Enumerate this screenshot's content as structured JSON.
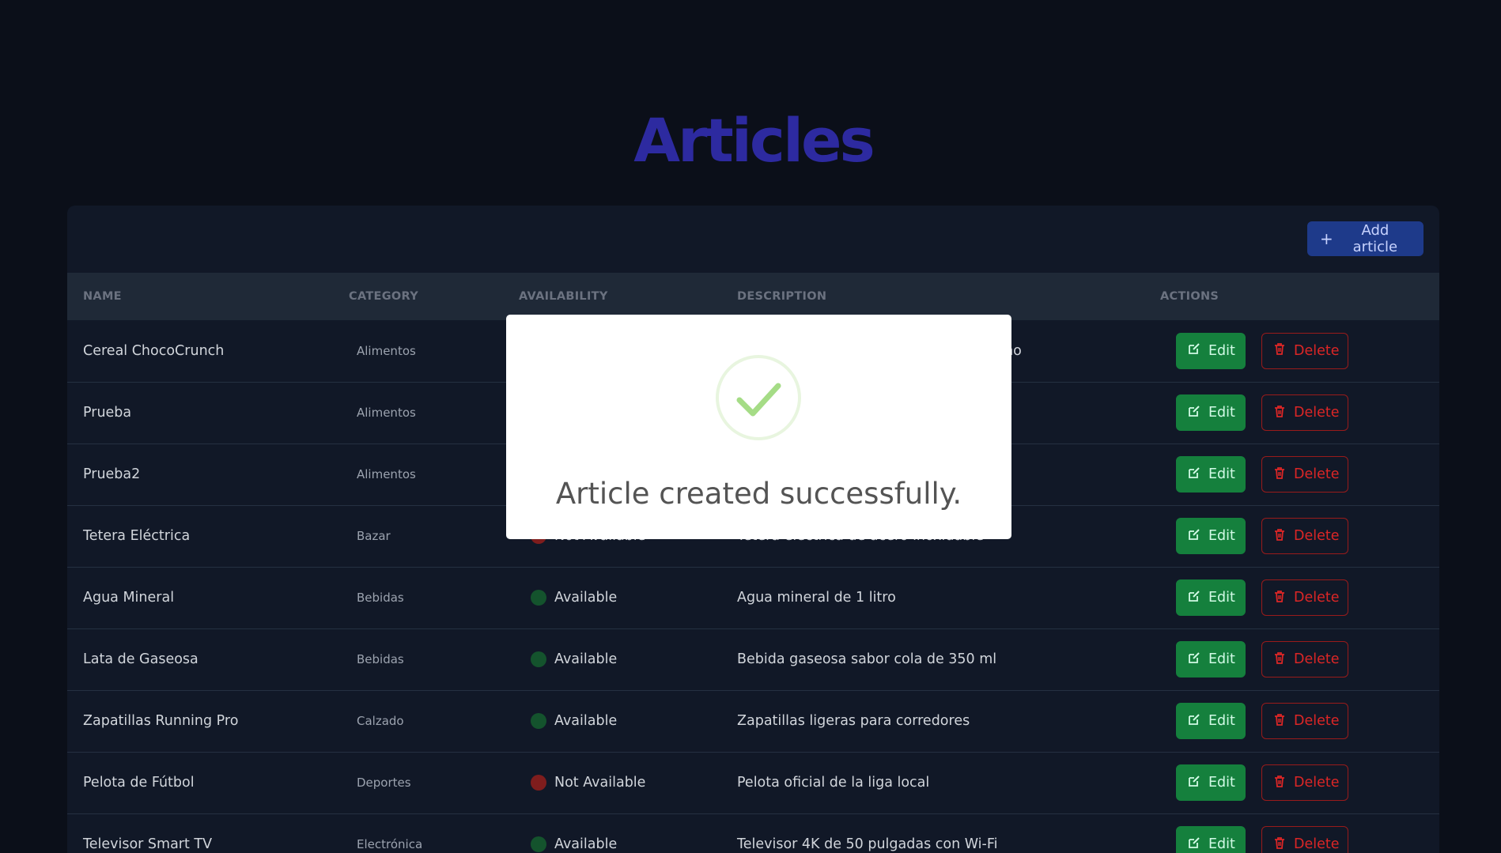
{
  "page": {
    "title": "Articles"
  },
  "toolbar": {
    "add_label": "Add article"
  },
  "table": {
    "headers": [
      "NAME",
      "CATEGORY",
      "AVAILABILITY",
      "DESCRIPTION",
      "ACTIONS"
    ],
    "rows": [
      {
        "name": "Cereal ChocoCrunch",
        "category": "Alimentos",
        "availability": "",
        "status": "",
        "description": "uno"
      },
      {
        "name": "Prueba",
        "category": "Alimentos",
        "availability": "",
        "status": "",
        "description": ""
      },
      {
        "name": "Prueba2",
        "category": "Alimentos",
        "availability": "",
        "status": "",
        "description": ""
      },
      {
        "name": "Tetera Eléctrica",
        "category": "Bazar",
        "availability": "Not Available",
        "status": "red",
        "description": "Tetera eléctrica de acero inoxidable"
      },
      {
        "name": "Agua Mineral",
        "category": "Bebidas",
        "availability": "Available",
        "status": "green",
        "description": "Agua mineral de 1 litro"
      },
      {
        "name": "Lata de Gaseosa",
        "category": "Bebidas",
        "availability": "Available",
        "status": "green",
        "description": "Bebida gaseosa sabor cola de 350 ml"
      },
      {
        "name": "Zapatillas Running Pro",
        "category": "Calzado",
        "availability": "Available",
        "status": "green",
        "description": "Zapatillas ligeras para corredores"
      },
      {
        "name": "Pelota de Fútbol",
        "category": "Deportes",
        "availability": "Not Available",
        "status": "red",
        "description": "Pelota oficial de la liga local"
      },
      {
        "name": "Televisor Smart TV",
        "category": "Electrónica",
        "availability": "Available",
        "status": "green",
        "description": "Televisor 4K de 50 pulgadas con Wi-Fi"
      }
    ],
    "edit_label": "Edit",
    "delete_label": "Delete"
  },
  "modal": {
    "message": "Article created successfully.",
    "icon": "success-check-icon"
  },
  "colors": {
    "background": "#0b0f19",
    "title": "#2d2aa0",
    "primary": "#1e3a8a",
    "edit": "#15803d",
    "delete": "#dc2626",
    "available": "#14532d",
    "not_available": "#7f1d1d",
    "success_check": "#a5dc86"
  }
}
